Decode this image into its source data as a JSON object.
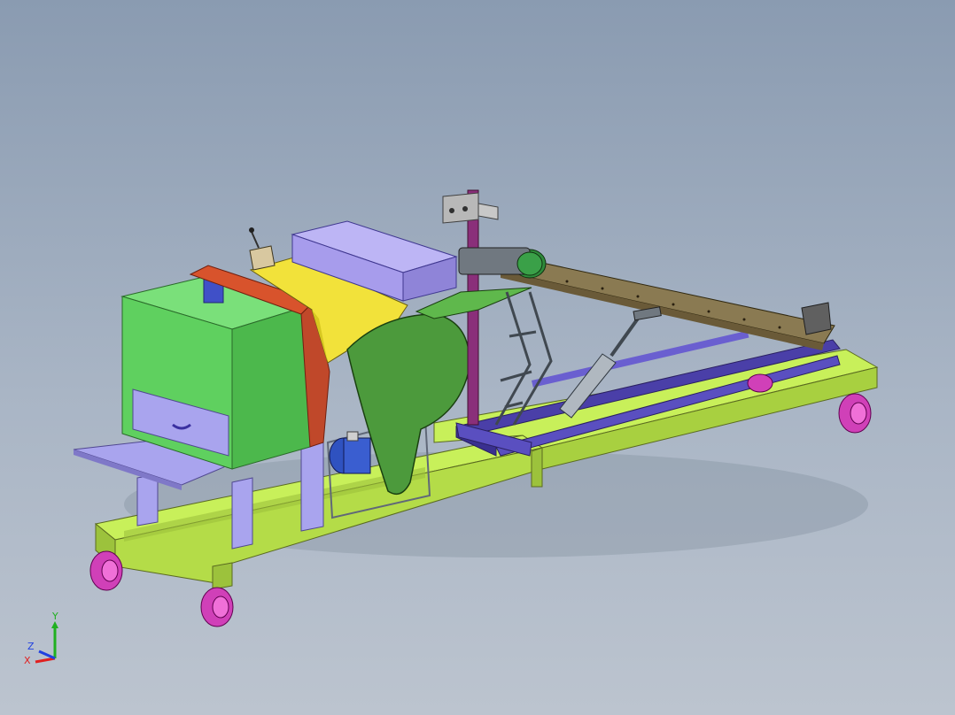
{
  "viewport": {
    "background_top": "#8a9bb1",
    "background_bottom": "#bcc4cf"
  },
  "triad": {
    "x_label": "X",
    "y_label": "Y",
    "z_label": "Z",
    "x_color": "#e02020",
    "y_color": "#20b020",
    "z_color": "#2040e0"
  },
  "model": {
    "parts": [
      "frame",
      "wheels",
      "hopper",
      "drawer",
      "side-shelf",
      "yellow-cover",
      "top-cover",
      "belt-guard",
      "motor",
      "conveyor",
      "control-box",
      "mast",
      "scissor-lift",
      "cylinder",
      "rails"
    ],
    "colors": {
      "frame": "#c8f05a",
      "frame_dark": "#9cc23c",
      "wheel": "#d040b8",
      "hopper": "#5fd05f",
      "hopper_dark": "#3f9a3f",
      "drawer": "#a9a4ee",
      "yellow_cover": "#f2e23a",
      "red_trim": "#d8532c",
      "top_cover": "#a79cec",
      "belt_guard": "#4c9a3c",
      "motor": "#2f52c0",
      "conveyor": "#8a7a52",
      "rails": "#4a3fa8",
      "mast": "#8a2f7a"
    }
  }
}
